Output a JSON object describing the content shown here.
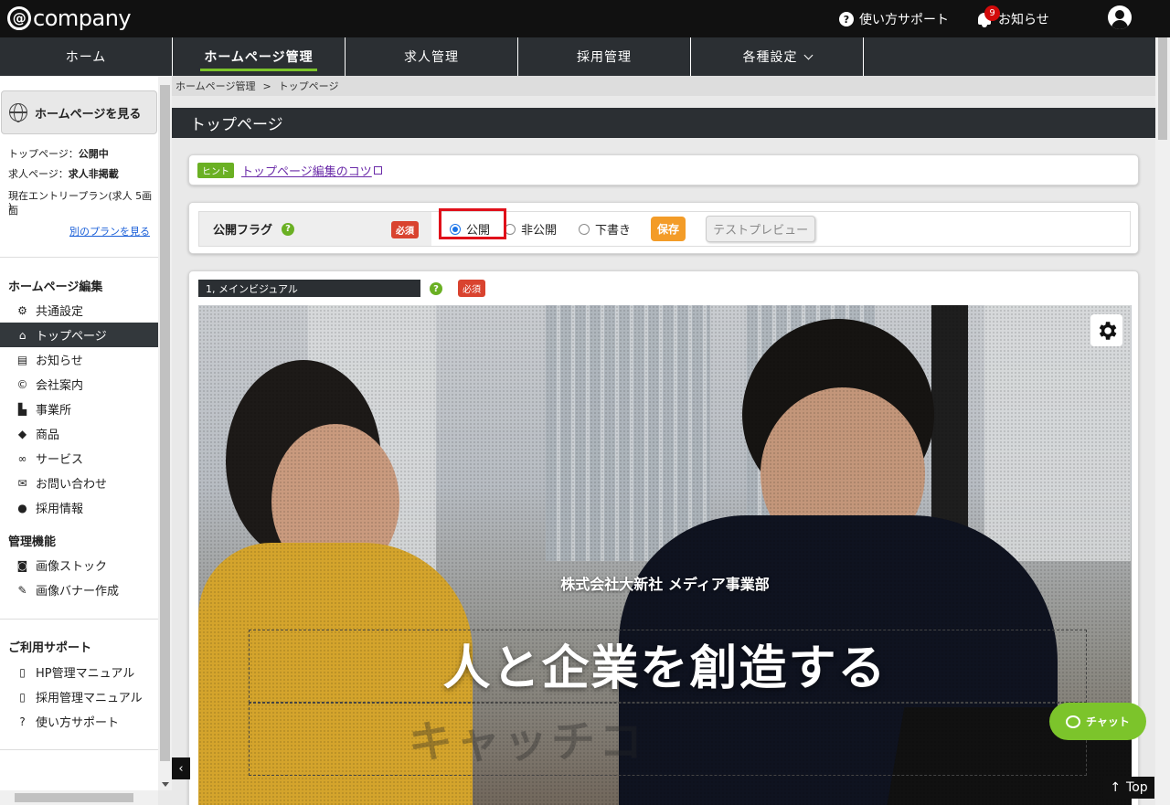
{
  "header": {
    "logo_text": "company",
    "help_label": "使い方サポート",
    "news_label": "お知らせ",
    "news_badge": "9"
  },
  "nav": {
    "items": [
      {
        "label": "ホーム"
      },
      {
        "label": "ホームページ管理"
      },
      {
        "label": "求人管理"
      },
      {
        "label": "採用管理"
      },
      {
        "label": "各種設定"
      }
    ]
  },
  "sidebar": {
    "view_hp": "ホームページを見る",
    "status": {
      "top_label": "トップページ：",
      "top_value": "公開中",
      "job_label": "求人ページ：",
      "job_value": "求人非掲載",
      "plan": "現在エントリープラン(求人 5画面",
      "plan2": ")"
    },
    "plan_link": "別のプランを見る",
    "sections": {
      "edit": "ホームページ編集",
      "manage": "管理機能",
      "support": "ご利用サポート"
    },
    "edit_items": [
      {
        "label": "共通設定",
        "icon": "gear-icon"
      },
      {
        "label": "トップページ",
        "icon": "home-icon"
      },
      {
        "label": "お知らせ",
        "icon": "newspaper-icon"
      },
      {
        "label": "会社案内",
        "icon": "copyright-icon"
      },
      {
        "label": "事業所",
        "icon": "factory-icon"
      },
      {
        "label": "商品",
        "icon": "box-icon"
      },
      {
        "label": "サービス",
        "icon": "handshake-icon"
      },
      {
        "label": "お問い合わせ",
        "icon": "envelope-icon"
      },
      {
        "label": "採用情報",
        "icon": "user-circle-icon"
      }
    ],
    "manage_items": [
      {
        "label": "画像ストック",
        "icon": "camera-icon"
      },
      {
        "label": "画像バナー作成",
        "icon": "pencil-icon"
      }
    ],
    "support_items": [
      {
        "label": "HP管理マニュアル",
        "icon": "pdf-icon"
      },
      {
        "label": "採用管理マニュアル",
        "icon": "pdf-icon"
      },
      {
        "label": "使い方サポート",
        "icon": "question-icon"
      }
    ]
  },
  "main": {
    "breadcrumb": [
      "ホームページ管理",
      ">",
      "トップページ"
    ],
    "title": "トップページ",
    "hint_tag": "ヒント",
    "hint_link": "トップページ編集のコツ",
    "flag": {
      "label": "公開フラグ",
      "required": "必須",
      "options": [
        "公開",
        "非公開",
        "下書き"
      ],
      "selected": "公開",
      "save": "保存",
      "preview": "テストプレビュー"
    },
    "visual": {
      "section_label": "1, メインビジュアル",
      "required": "必須",
      "company": "株式会社大新社 メディア事業部",
      "catch": "人と企業を創造する",
      "ghost": "キャッチコ"
    }
  },
  "chat_label": "チャット",
  "top_label": "Top"
}
